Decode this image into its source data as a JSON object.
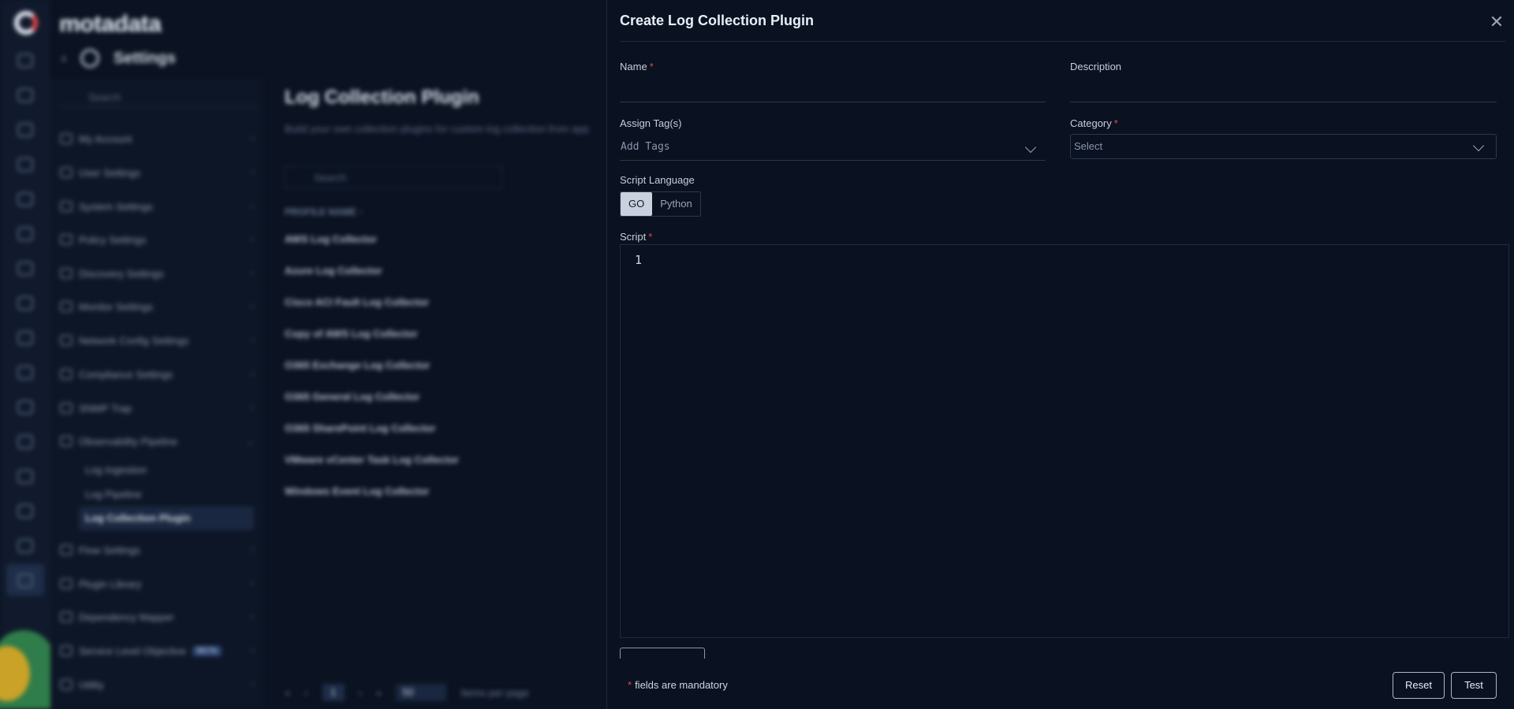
{
  "app": {
    "brand": "motadata",
    "section_title": "Settings",
    "sidebar_search_placeholder": "Search",
    "sidebar_items": [
      {
        "label": "My Account"
      },
      {
        "label": "User Settings"
      },
      {
        "label": "System Settings"
      },
      {
        "label": "Policy Settings"
      },
      {
        "label": "Discovery Settings"
      },
      {
        "label": "Monitor Settings"
      },
      {
        "label": "Network Config Settings"
      },
      {
        "label": "Compliance Settings"
      },
      {
        "label": "SNMP Trap"
      },
      {
        "label": "Observability Pipeline"
      }
    ],
    "pipeline_subitems": [
      "Log Ingestion",
      "Log Pipeline",
      "Log Collection Plugin"
    ],
    "sidebar_items_after": [
      {
        "label": "Flow Settings"
      },
      {
        "label": "Plugin Library"
      },
      {
        "label": "Dependency Mapper"
      },
      {
        "label": "Service Level Objective",
        "badge": "BETA"
      },
      {
        "label": "Utility"
      }
    ]
  },
  "main": {
    "title": "Log Collection Plugin",
    "subtitle": "Build your own collection plugins for custom log collection from app",
    "search_placeholder": "Search",
    "column_header": "PROFILE NAME ↑",
    "rows": [
      "AWS Log Collector",
      "Azure Log Collector",
      "Cisco ACI Fault Log Collector",
      "Copy of AWS Log Collector",
      "O365 Exchange Log Collector",
      "O365 General Log Collector",
      "O365 SharePoint Log Collector",
      "VMware vCenter Task Log Collector",
      "Windows Event Log Collector"
    ],
    "pager": {
      "page": "1",
      "per_page": "50",
      "per_page_label": "Items per page"
    }
  },
  "drawer": {
    "title": "Create Log Collection Plugin",
    "name_label": "Name",
    "description_label": "Description",
    "tags_label": "Assign Tag(s)",
    "tags_placeholder": "Add Tags",
    "category_label": "Category",
    "category_placeholder": "Select",
    "language_label": "Script Language",
    "languages": [
      "GO",
      "Python"
    ],
    "selected_language": "GO",
    "script_label": "Script",
    "editor_line": "1",
    "mandatory_note": "fields are mandatory",
    "reset_label": "Reset",
    "test_label": "Test"
  },
  "colors": {
    "required": "#e5484d",
    "background": "#0a1120"
  }
}
